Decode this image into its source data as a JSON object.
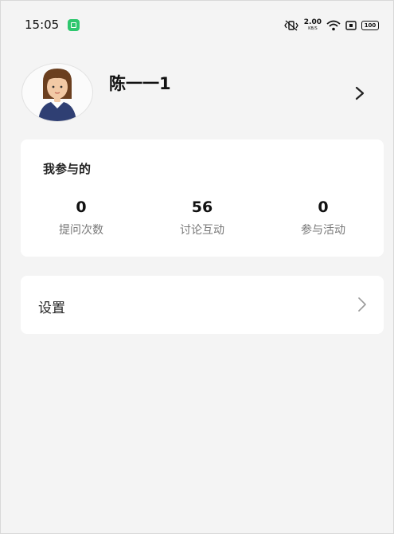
{
  "status_bar": {
    "time": "15:05",
    "net_speed_value": "2.00",
    "net_speed_unit": "KB/S",
    "battery": "100"
  },
  "profile": {
    "name": "陈一一1"
  },
  "participation": {
    "title": "我参与的",
    "stats": [
      {
        "value": "0",
        "label": "提问次数"
      },
      {
        "value": "56",
        "label": "讨论互动"
      },
      {
        "value": "0",
        "label": "参与活动"
      }
    ]
  },
  "settings": {
    "label": "设置"
  },
  "icons": {
    "app_badge": "app-badge-icon",
    "vibrate": "vibrate-icon",
    "wifi": "wifi-icon",
    "sim": "sim-icon",
    "battery": "battery-icon",
    "profile_chevron": "chevron-right-icon",
    "settings_chevron": "chevron-right-icon"
  },
  "colors": {
    "background": "#f4f4f4",
    "card": "#ffffff",
    "app_badge": "#2ec76e",
    "label_gray": "#777777"
  }
}
